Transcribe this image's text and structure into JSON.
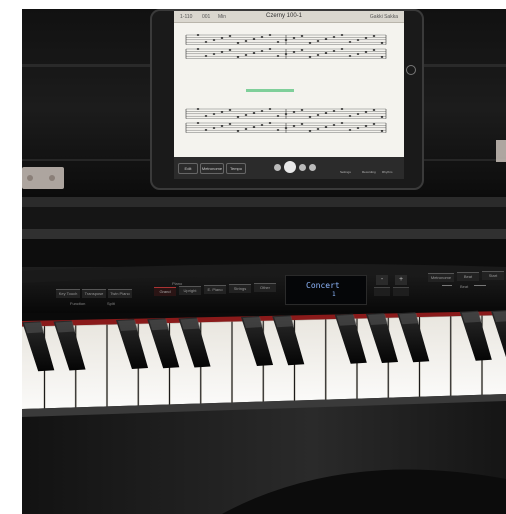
{
  "tablet": {
    "score_title": "Czerny 100-1",
    "header_right": "Gakki Sakka",
    "header_left_items": [
      "1-110",
      "001",
      "Min"
    ],
    "toolbar_buttons": [
      "Edit",
      "Metronome",
      "Tempo"
    ],
    "right_controls": [
      "Settings",
      "Recording",
      "Rhythm"
    ]
  },
  "piano_panel": {
    "left_buttons": [
      "Key Touch",
      "Transpose",
      "Twin Piano"
    ],
    "left_sub_labels": [
      "Function",
      "Split"
    ],
    "tone_group_label": "Piano",
    "tone_buttons": [
      "Grand",
      "Upright",
      "E. Piano",
      "Strings",
      "Other"
    ],
    "display_text": "Concert",
    "display_cursor": "1",
    "volume_buttons": [
      "-",
      "+"
    ],
    "right_buttons": [
      "Metronome",
      "Beat",
      "Start"
    ],
    "right_sub_labels": [
      "Beat"
    ],
    "pedal_icon_names": [
      "left-pedal-icon",
      "right-pedal-icon"
    ]
  },
  "colors": {
    "piano_black": "#0b0b0b",
    "tablet_screen": "#f4f3ee",
    "display_text": "#8fb8ff",
    "red_felt": "#8a1a1a",
    "key_white": "#f2efe8",
    "highlight_bar": "#7fcf9a"
  }
}
